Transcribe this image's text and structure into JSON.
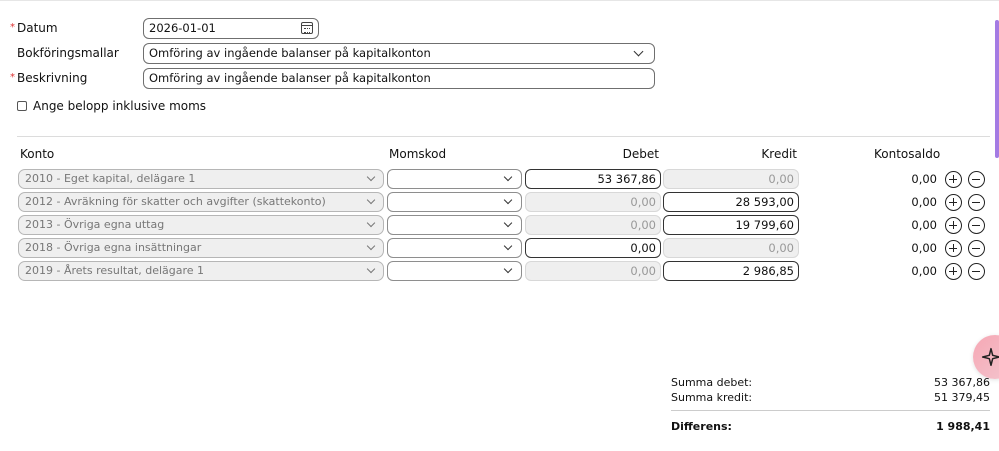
{
  "form": {
    "datum_label": "Datum",
    "datum_value": "2026-01-01",
    "mallar_label": "Bokföringsmallar",
    "mallar_value": "Omföring av ingående balanser på kapitalkonton",
    "beskrivning_label": "Beskrivning",
    "beskrivning_value": "Omföring av ingående balanser på kapitalkonton",
    "required_marker": "*",
    "moms_checkbox_label": "Ange belopp inklusive moms",
    "moms_checkbox_checked": false
  },
  "table": {
    "headers": {
      "konto": "Konto",
      "momskod": "Momskod",
      "debet": "Debet",
      "kredit": "Kredit",
      "saldo": "Kontosaldo"
    },
    "rows": [
      {
        "konto": "2010 - Eget kapital, delägare 1",
        "momskod": "",
        "debet": "53 367,86",
        "kredit": "0,00",
        "saldo": "0,00",
        "active": "debet"
      },
      {
        "konto": "2012 - Avräkning för skatter och avgifter (skattekonto)",
        "momskod": "",
        "debet": "0,00",
        "kredit": "28 593,00",
        "saldo": "0,00",
        "active": "kredit"
      },
      {
        "konto": "2013 - Övriga egna uttag",
        "momskod": "",
        "debet": "0,00",
        "kredit": "19 799,60",
        "saldo": "0,00",
        "active": "kredit"
      },
      {
        "konto": "2018 - Övriga egna insättningar",
        "momskod": "",
        "debet": "0,00",
        "kredit": "0,00",
        "saldo": "0,00",
        "active": "debet"
      },
      {
        "konto": "2019 - Årets resultat, delägare 1",
        "momskod": "",
        "debet": "0,00",
        "kredit": "2 986,85",
        "saldo": "0,00",
        "active": "kredit"
      }
    ]
  },
  "summary": {
    "debet_label": "Summa debet:",
    "debet_value": "53 367,86",
    "kredit_label": "Summa kredit:",
    "kredit_value": "51 379,45",
    "diff_label": "Differens:",
    "diff_value": "1 988,41"
  },
  "icons": {
    "calendar": "calendar-icon",
    "dropdown": "chevron-down-icon",
    "add_row": "plus-circle-icon",
    "remove_row": "minus-circle-icon",
    "assistant": "sparkle-icon"
  },
  "colors": {
    "required": "#dd3333",
    "accent_scroll": "#a47be3",
    "assistant_bg": "#f6a7b4"
  }
}
